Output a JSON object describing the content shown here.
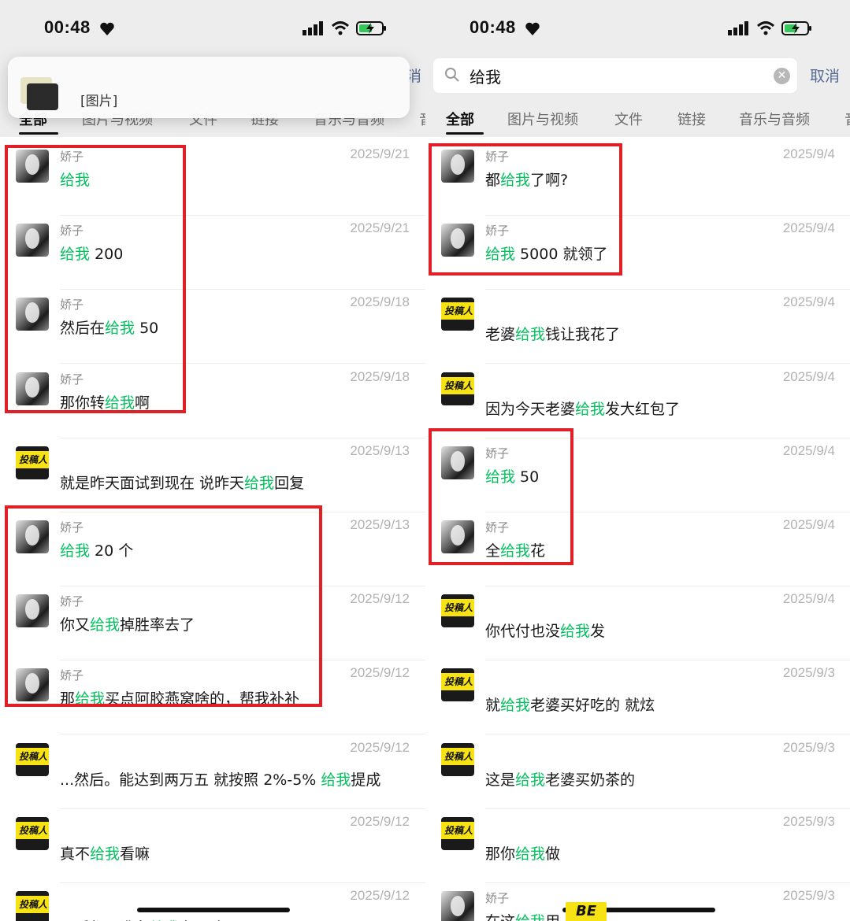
{
  "left": {
    "status": {
      "time": "00:48"
    },
    "cancel_label": "消",
    "overlay": {
      "text": "[图片]"
    },
    "tabs": [
      "全部",
      "图片与视频",
      "文件",
      "链接",
      "音乐与音频",
      "音"
    ],
    "rows": [
      {
        "avatar": "photo",
        "sender": "娇子",
        "parts": [
          {
            "t": "给我",
            "h": true
          }
        ],
        "date": "2025/9/21"
      },
      {
        "avatar": "photo",
        "sender": "娇子",
        "parts": [
          {
            "t": "给我",
            "h": true
          },
          {
            "t": " 200"
          }
        ],
        "date": "2025/9/21"
      },
      {
        "avatar": "photo",
        "sender": "娇子",
        "parts": [
          {
            "t": "然后在"
          },
          {
            "t": "给我",
            "h": true
          },
          {
            "t": " 50"
          }
        ],
        "date": "2025/9/18"
      },
      {
        "avatar": "photo",
        "sender": "娇子",
        "parts": [
          {
            "t": "那你转"
          },
          {
            "t": "给我",
            "h": true
          },
          {
            "t": "啊"
          }
        ],
        "date": "2025/9/18"
      },
      {
        "avatar": "tg",
        "badge": "投稿人",
        "sender": "",
        "parts": [
          {
            "t": "就是昨天面试到现在 说昨天"
          },
          {
            "t": "给我",
            "h": true
          },
          {
            "t": "回复"
          }
        ],
        "date": "2025/9/13"
      },
      {
        "avatar": "photo",
        "sender": "娇子",
        "parts": [
          {
            "t": "给我",
            "h": true
          },
          {
            "t": " 20 个"
          }
        ],
        "date": "2025/9/13"
      },
      {
        "avatar": "photo",
        "sender": "娇子",
        "parts": [
          {
            "t": "你又"
          },
          {
            "t": "给我",
            "h": true
          },
          {
            "t": "掉胜率去了"
          }
        ],
        "date": "2025/9/12"
      },
      {
        "avatar": "photo",
        "sender": "娇子",
        "parts": [
          {
            "t": "那"
          },
          {
            "t": "给我",
            "h": true
          },
          {
            "t": "买点阿胶燕窝啥的，帮我补补"
          }
        ],
        "date": "2025/9/12"
      },
      {
        "avatar": "tg",
        "badge": "投稿人",
        "sender": "",
        "parts": [
          {
            "t": "...然后。能达到两万五 就按照 2%-5% "
          },
          {
            "t": "给我",
            "h": true
          },
          {
            "t": "提成"
          }
        ],
        "date": "2025/9/12"
      },
      {
        "avatar": "tg",
        "badge": "投稿人",
        "sender": "",
        "parts": [
          {
            "t": "真不"
          },
          {
            "t": "给我",
            "h": true
          },
          {
            "t": "看嘛"
          }
        ],
        "date": "2025/9/12"
      },
      {
        "avatar": "tg",
        "badge": "投稿人",
        "sender": "",
        "parts": [
          {
            "t": "以后都不准备"
          },
          {
            "t": "给我",
            "h": true
          },
          {
            "t": "有了嘛"
          }
        ],
        "date": "2025/9/12"
      }
    ]
  },
  "right": {
    "status": {
      "time": "00:48"
    },
    "search": {
      "value": "给我"
    },
    "cancel_label": "取消",
    "tabs": [
      "全部",
      "图片与视频",
      "文件",
      "链接",
      "音乐与音频",
      "音"
    ],
    "rows": [
      {
        "avatar": "photo",
        "sender": "娇子",
        "parts": [
          {
            "t": "都"
          },
          {
            "t": "给我",
            "h": true
          },
          {
            "t": "了啊?"
          }
        ],
        "date": "2025/9/4"
      },
      {
        "avatar": "photo",
        "sender": "娇子",
        "parts": [
          {
            "t": "给我",
            "h": true
          },
          {
            "t": " 5000 就领了"
          }
        ],
        "date": "2025/9/4"
      },
      {
        "avatar": "tg",
        "badge": "投稿人",
        "sender": "",
        "parts": [
          {
            "t": "老婆"
          },
          {
            "t": "给我",
            "h": true
          },
          {
            "t": "钱让我花了"
          }
        ],
        "date": "2025/9/4"
      },
      {
        "avatar": "tg",
        "badge": "投稿人",
        "sender": "",
        "parts": [
          {
            "t": "因为今天老婆"
          },
          {
            "t": "给我",
            "h": true
          },
          {
            "t": "发大红包了"
          }
        ],
        "date": "2025/9/4"
      },
      {
        "avatar": "photo",
        "sender": "娇子",
        "parts": [
          {
            "t": "给我",
            "h": true
          },
          {
            "t": " 50"
          }
        ],
        "date": "2025/9/4"
      },
      {
        "avatar": "photo",
        "sender": "娇子",
        "parts": [
          {
            "t": "全"
          },
          {
            "t": "给我",
            "h": true
          },
          {
            "t": "花"
          }
        ],
        "date": "2025/9/4"
      },
      {
        "avatar": "tg",
        "badge": "投稿人",
        "sender": "",
        "parts": [
          {
            "t": "你代付也没"
          },
          {
            "t": "给我",
            "h": true
          },
          {
            "t": "发"
          }
        ],
        "date": "2025/9/4"
      },
      {
        "avatar": "tg",
        "badge": "投稿人",
        "sender": "",
        "parts": [
          {
            "t": "就"
          },
          {
            "t": "给我",
            "h": true
          },
          {
            "t": "老婆买好吃的 就炫"
          }
        ],
        "date": "2025/9/3"
      },
      {
        "avatar": "tg",
        "badge": "投稿人",
        "sender": "",
        "parts": [
          {
            "t": "这是"
          },
          {
            "t": "给我",
            "h": true
          },
          {
            "t": "老婆买奶茶的"
          }
        ],
        "date": "2025/9/3"
      },
      {
        "avatar": "tg",
        "badge": "投稿人",
        "sender": "",
        "parts": [
          {
            "t": "那你"
          },
          {
            "t": "给我",
            "h": true
          },
          {
            "t": "做"
          }
        ],
        "date": "2025/9/3"
      },
      {
        "avatar": "photo",
        "sender": "娇子",
        "parts": [
          {
            "t": "在这"
          },
          {
            "t": "给我",
            "h": true
          },
          {
            "t": "用上"
          }
        ],
        "date": "2025/9/3"
      }
    ],
    "be_badge": "BE"
  },
  "colors": {
    "highlight": "#07c160",
    "link": "#576b95",
    "annotation": "#e01f26",
    "badge": "#f7e313"
  }
}
